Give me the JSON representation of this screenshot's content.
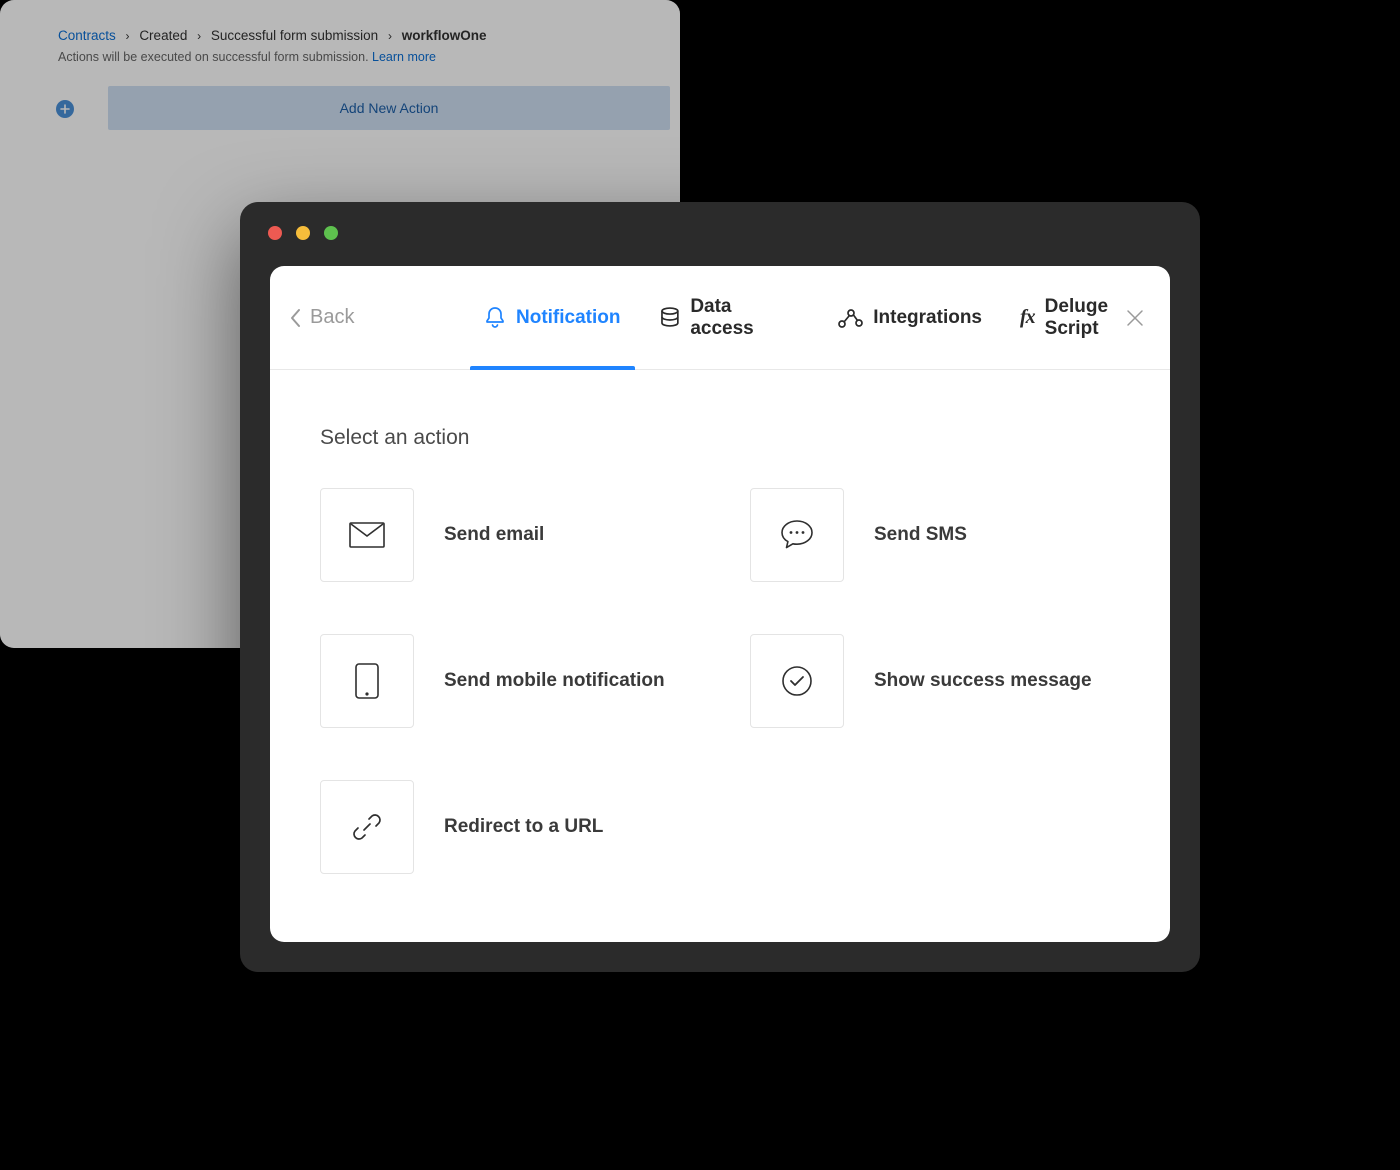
{
  "breadcrumb": {
    "root_link": "Contracts",
    "items": [
      "Created",
      "Successful form submission",
      "workflowOne"
    ]
  },
  "subtext": {
    "text": "Actions will be executed on successful form submission. ",
    "learn_more": "Learn more"
  },
  "add_action_label": "Add New Action",
  "modal": {
    "back_label": "Back",
    "tabs": [
      {
        "label": "Notification"
      },
      {
        "label": "Data access"
      },
      {
        "label": "Integrations"
      },
      {
        "label": "Deluge Script"
      }
    ],
    "section_title": "Select an action",
    "actions": [
      {
        "label": "Send email"
      },
      {
        "label": "Send SMS"
      },
      {
        "label": "Send mobile notification"
      },
      {
        "label": "Show success message"
      },
      {
        "label": "Redirect to a URL"
      }
    ]
  }
}
